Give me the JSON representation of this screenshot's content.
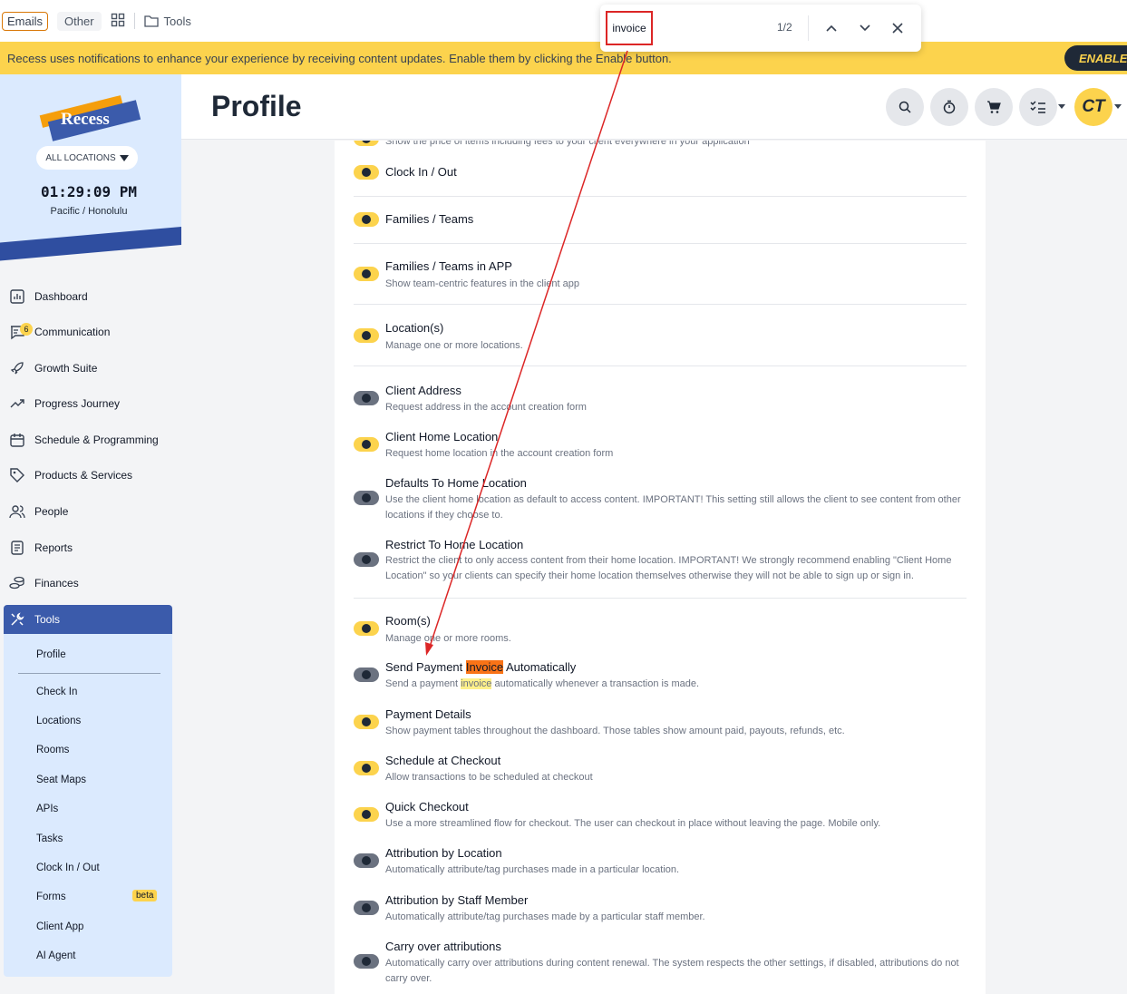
{
  "bookmarks": {
    "emails": "Emails",
    "other": "Other",
    "tools": "Tools"
  },
  "banner": {
    "text": "Recess uses notifications to enhance your experience by receiving content updates. Enable them by clicking the Enable button.",
    "enable": "ENABLE"
  },
  "find": {
    "query": "invoice",
    "count": "1/2"
  },
  "sidebar": {
    "logo": "Recess",
    "locations": "ALL LOCATIONS",
    "clock": "01:29:09 PM",
    "timezone": "Pacific / Honolulu",
    "nav": [
      {
        "label": "Dashboard"
      },
      {
        "label": "Communication",
        "badge": "6"
      },
      {
        "label": "Growth Suite"
      },
      {
        "label": "Progress Journey"
      },
      {
        "label": "Schedule & Programming"
      },
      {
        "label": "Products & Services"
      },
      {
        "label": "People"
      },
      {
        "label": "Reports"
      },
      {
        "label": "Finances"
      }
    ],
    "active": "Tools",
    "sub": [
      "Profile",
      "Check In",
      "Locations",
      "Rooms",
      "Seat Maps",
      "APIs",
      "Tasks",
      "Clock In / Out",
      "Forms",
      "Client App",
      "AI Agent"
    ],
    "beta": "beta"
  },
  "header": {
    "title": "Profile",
    "avatar": "CT"
  },
  "settings": {
    "top_desc": "Show the price of items including fees to your client everywhere in your application",
    "clock": {
      "title": "Clock In / Out"
    },
    "families": {
      "title": "Families / Teams"
    },
    "families_app": {
      "title": "Families / Teams in APP",
      "desc": "Show team-centric features in the client app"
    },
    "locations": {
      "title": "Location(s)",
      "desc": "Manage one or more locations."
    },
    "client_address": {
      "title": "Client Address",
      "desc": "Request address in the account creation form"
    },
    "home_location": {
      "title": "Client Home Location",
      "desc": "Request home location in the account creation form"
    },
    "defaults_home": {
      "title": "Defaults To Home Location",
      "desc": "Use the client home location as default to access content. IMPORTANT! This setting still allows the client to see content from other locations if they choose to."
    },
    "restrict_home": {
      "title": "Restrict To Home Location",
      "desc": "Restrict the client to only access content from their home location. IMPORTANT! We strongly recommend enabling \"Client Home Location\" so your clients can specify their home location themselves otherwise they will not be able to sign up or sign in."
    },
    "rooms": {
      "title": "Room(s)",
      "desc": "Manage one or more rooms."
    },
    "send_invoice": {
      "title_pre": "Send Payment ",
      "title_hl": "Invoice",
      "title_post": " Automatically",
      "desc_pre": "Send a payment ",
      "desc_hl": "invoice",
      "desc_post": " automatically whenever a transaction is made."
    },
    "payment_details": {
      "title": "Payment Details",
      "desc": "Show payment tables throughout the dashboard. Those tables show amount paid, payouts, refunds, etc."
    },
    "schedule_checkout": {
      "title": "Schedule at Checkout",
      "desc": "Allow transactions to be scheduled at checkout"
    },
    "quick_checkout": {
      "title": "Quick Checkout",
      "desc": "Use a more streamlined flow for checkout. The user can checkout in place without leaving the page. Mobile only."
    },
    "attr_location": {
      "title": "Attribution by Location",
      "desc": "Automatically attribute/tag purchases made in a particular location."
    },
    "attr_staff": {
      "title": "Attribution by Staff Member",
      "desc": "Automatically attribute/tag purchases made by a particular staff member."
    },
    "carry_over": {
      "title": "Carry over attributions",
      "desc": "Automatically carry over attributions during content renewal. The system respects the other settings, if disabled, attributions do not carry over."
    }
  }
}
